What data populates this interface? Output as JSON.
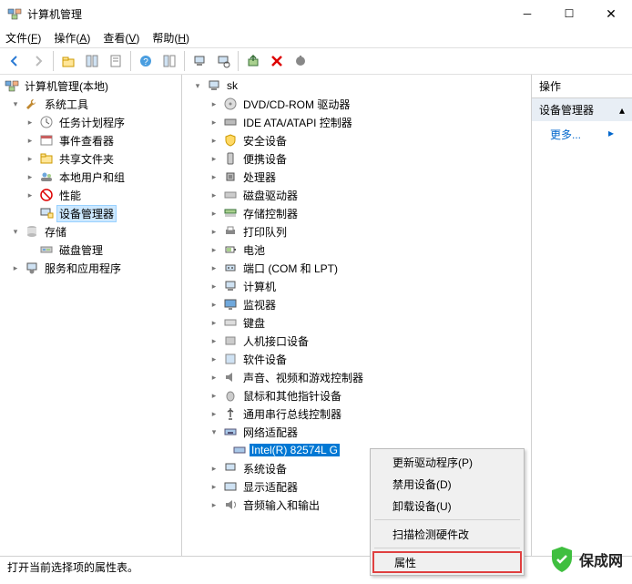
{
  "titlebar": {
    "title": "计算机管理"
  },
  "menu": {
    "file": "文件(F)",
    "action": "操作(A)",
    "view": "查看(V)",
    "help": "帮助(H)"
  },
  "left": {
    "root": "计算机管理(本地)",
    "systools": "系统工具",
    "taskscheduler": "任务计划程序",
    "eventviewer": "事件查看器",
    "sharedfolders": "共享文件夹",
    "localusers": "本地用户和组",
    "performance": "性能",
    "devicemgr": "设备管理器",
    "storage": "存储",
    "diskmgmt": "磁盘管理",
    "services": "服务和应用程序"
  },
  "mid": {
    "root": "sk",
    "dvd": "DVD/CD-ROM 驱动器",
    "ide": "IDE ATA/ATAPI 控制器",
    "security": "安全设备",
    "portable": "便携设备",
    "cpu": "处理器",
    "diskdrv": "磁盘驱动器",
    "storagectrl": "存储控制器",
    "printq": "打印队列",
    "battery": "电池",
    "ports": "端口 (COM 和 LPT)",
    "computers": "计算机",
    "monitors": "监视器",
    "keyboards": "键盘",
    "hid": "人机接口设备",
    "software": "软件设备",
    "sound": "声音、视频和游戏控制器",
    "mouse": "鼠标和其他指针设备",
    "usb": "通用串行总线控制器",
    "netadapters": "网络适配器",
    "intel": "Intel(R) 82574L G",
    "sysdev": "系统设备",
    "display": "显示适配器",
    "audio": "音频输入和输出"
  },
  "context": {
    "update": "更新驱动程序(P)",
    "disable": "禁用设备(D)",
    "uninstall": "卸载设备(U)",
    "scan": "扫描检测硬件改",
    "properties": "属性"
  },
  "right": {
    "header": "操作",
    "devmgr": "设备管理器",
    "more": "更多..."
  },
  "statusbar": "打开当前选择项的属性表。",
  "watermark": "保成网"
}
